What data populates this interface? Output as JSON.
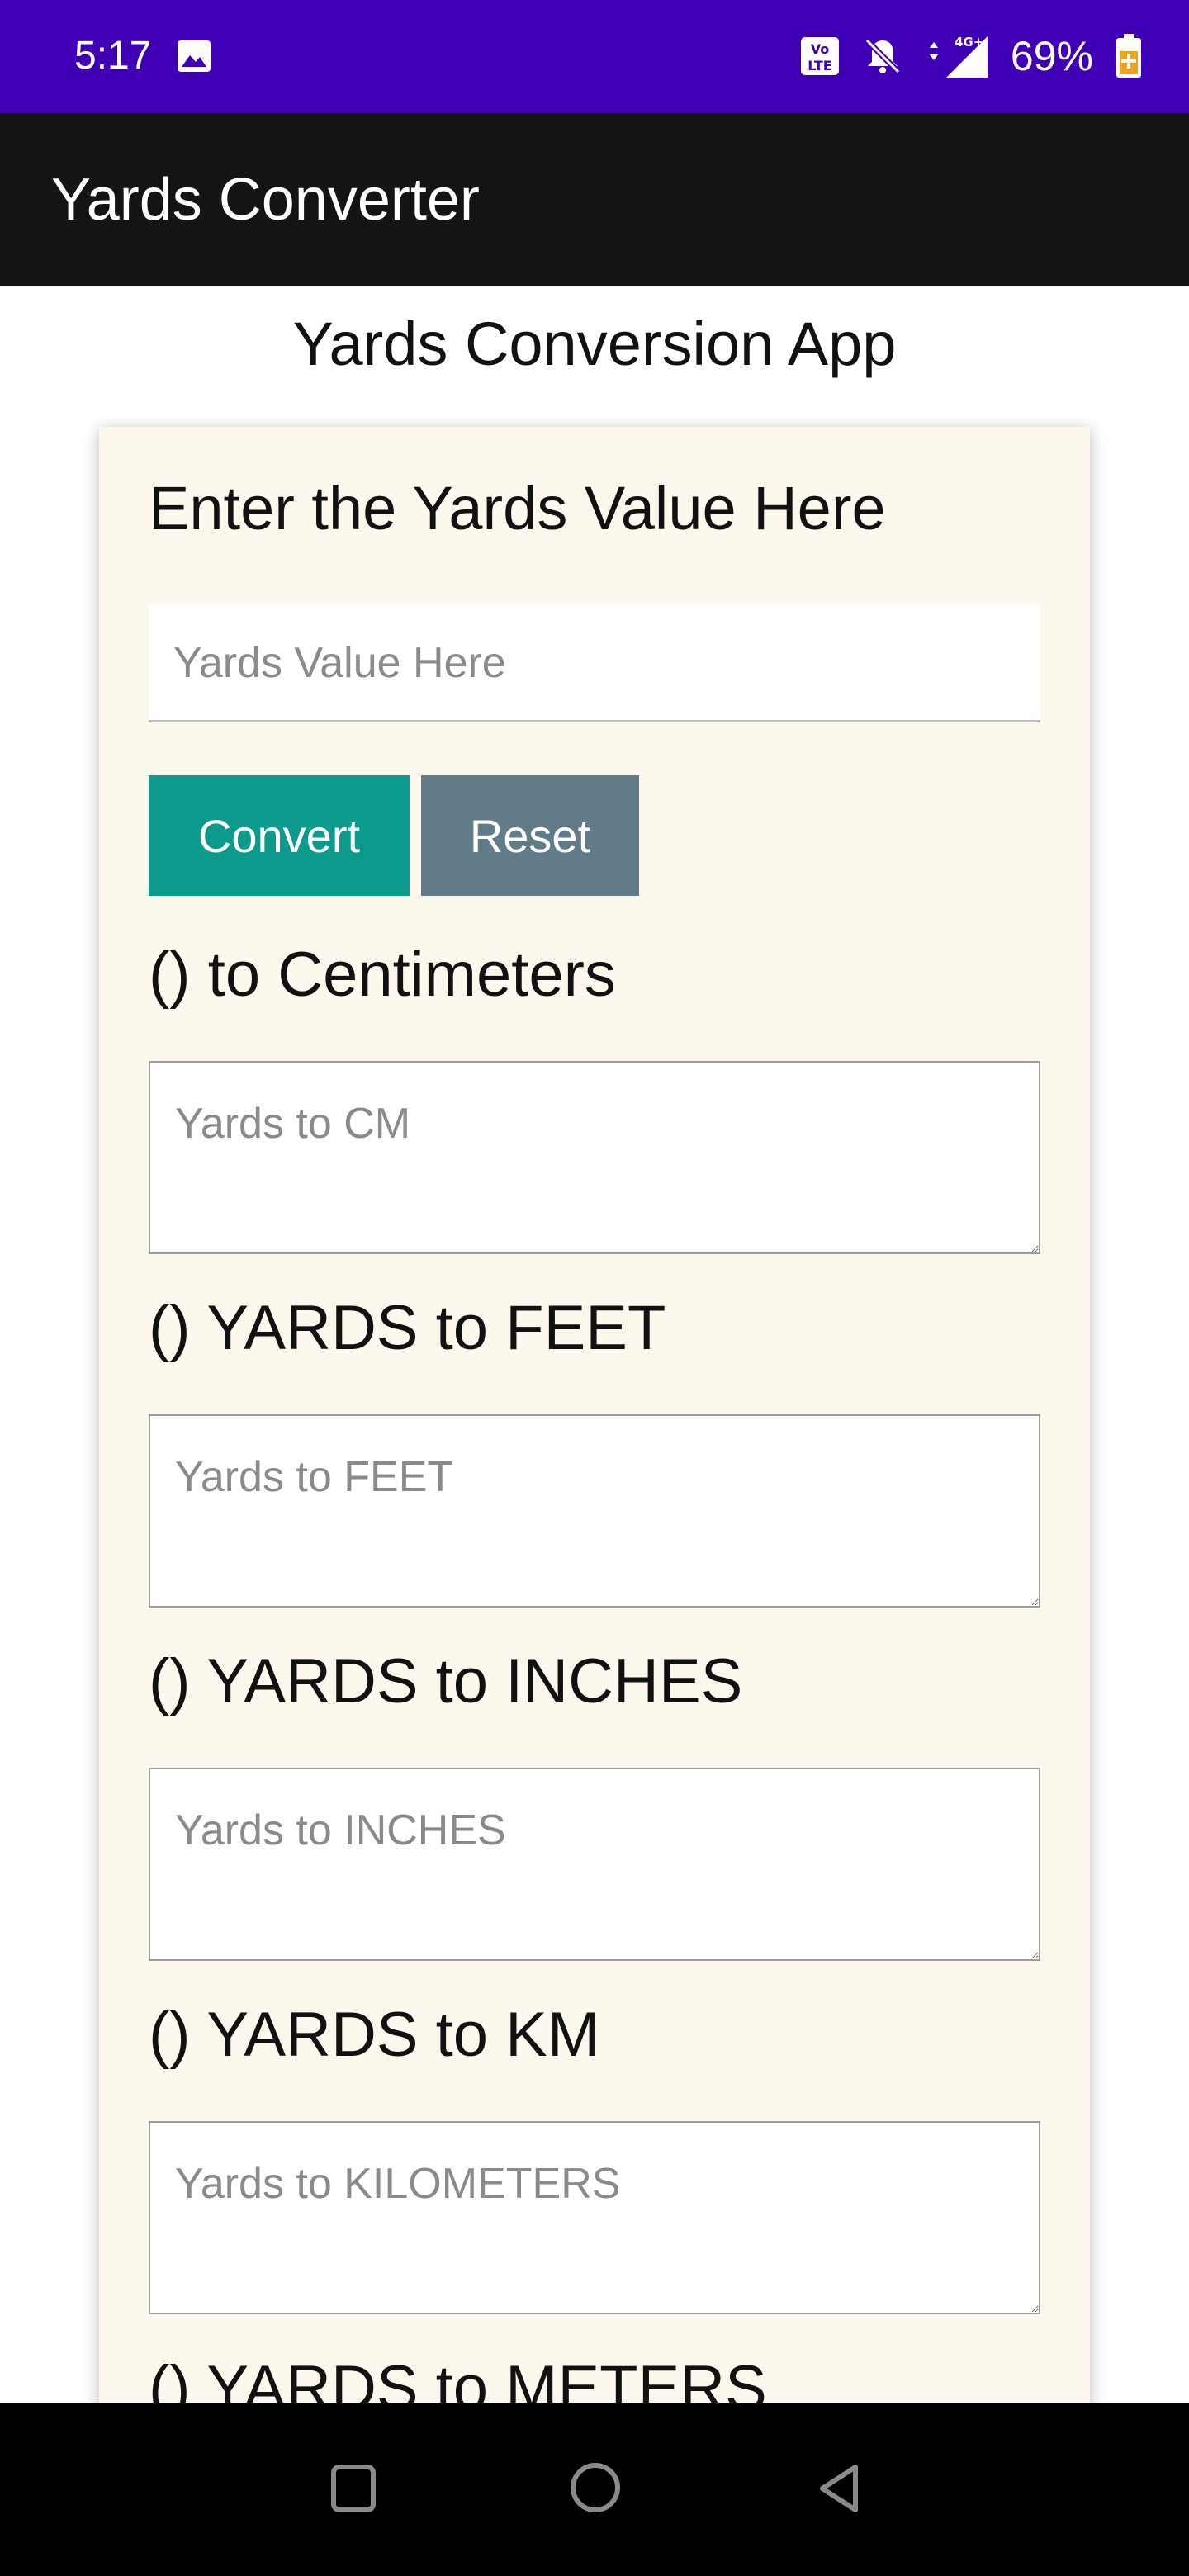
{
  "status_bar": {
    "time": "5:17",
    "battery": "69%",
    "icons": [
      "image-icon",
      "volte-icon",
      "bell-off-icon",
      "signal-4g-icon",
      "battery-charging-icon"
    ]
  },
  "app_bar": {
    "title": "Yards Converter"
  },
  "page": {
    "heading": "Yards Conversion App"
  },
  "card": {
    "title": "Enter the Yards Value Here",
    "input_placeholder": "Yards Value Here",
    "convert_label": "Convert",
    "reset_label": "Reset",
    "conversions": [
      {
        "label": "() to Centimeters",
        "placeholder": "Yards to CM"
      },
      {
        "label": "() YARDS to FEET",
        "placeholder": "Yards to FEET"
      },
      {
        "label": "() YARDS to INCHES",
        "placeholder": "Yards to INCHES"
      },
      {
        "label": "() YARDS to KM",
        "placeholder": "Yards to KILOMETERS"
      },
      {
        "label": "() YARDS to METERS",
        "placeholder": ""
      }
    ]
  },
  "nav_bar": {
    "icons": [
      "recents-square-icon",
      "home-circle-icon",
      "back-triangle-icon"
    ]
  },
  "colors": {
    "status_bar": "#3f00b5",
    "app_bar": "#141414",
    "card_bg": "#fdf8ee",
    "convert_button": "#0b9a8b",
    "reset_button": "#617b89"
  }
}
